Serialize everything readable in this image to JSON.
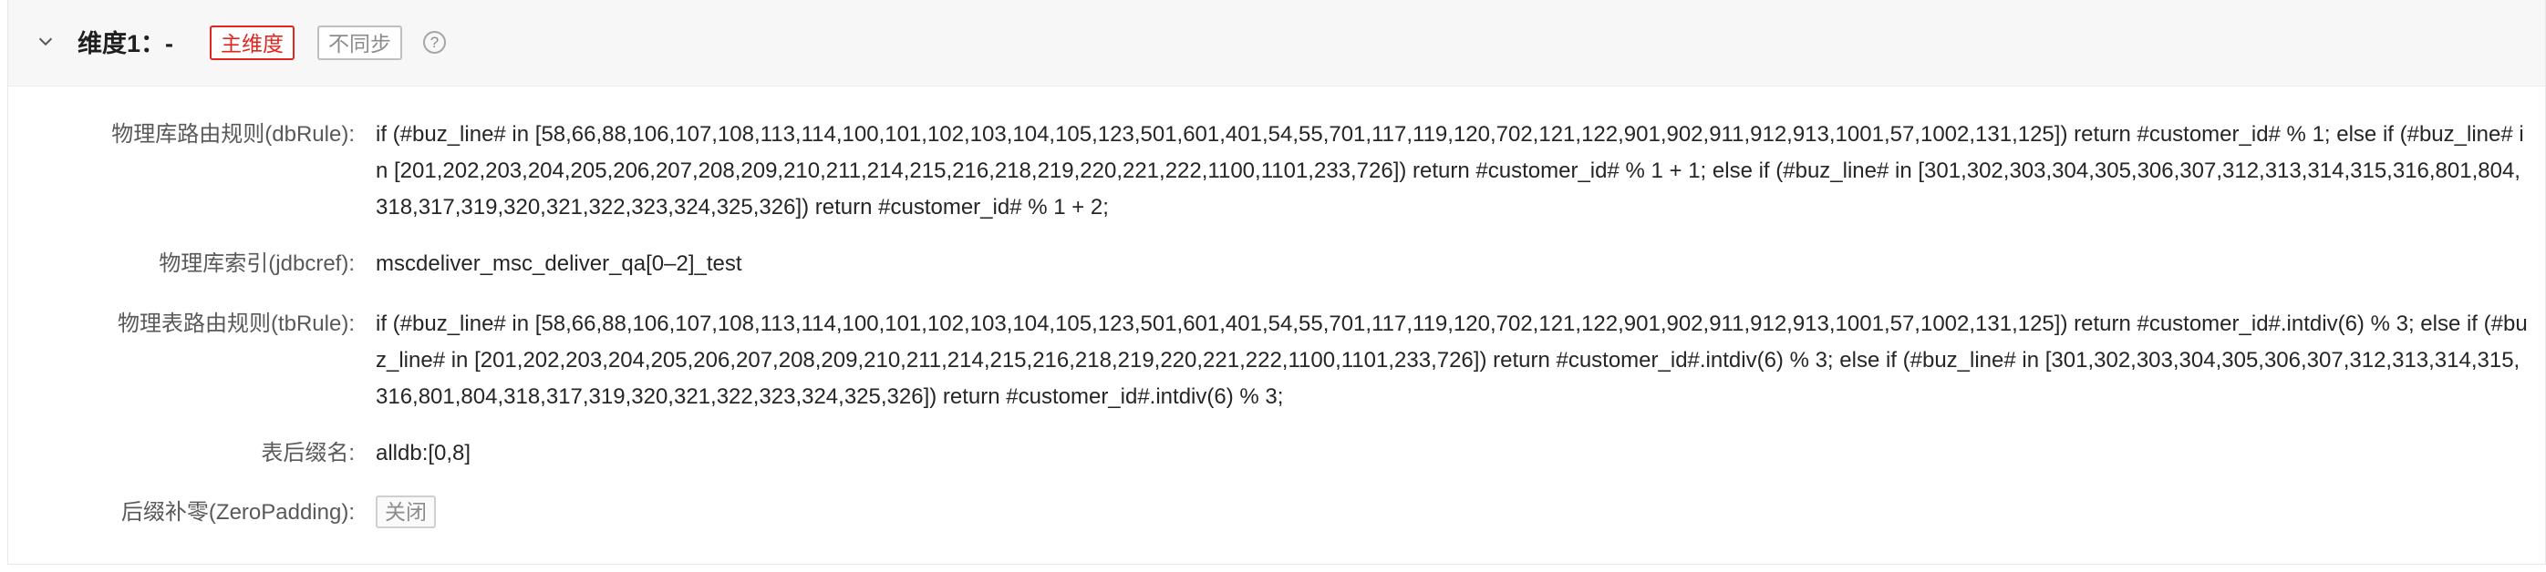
{
  "header": {
    "title": "维度1：-",
    "tag_main": "主维度",
    "tag_sync": "不同步",
    "help_glyph": "?"
  },
  "fields": {
    "db_rule": {
      "label": "物理库路由规则(dbRule):",
      "value": "if (#buz_line# in [58,66,88,106,107,108,113,114,100,101,102,103,104,105,123,501,601,401,54,55,701,117,119,120,702,121,122,901,902,911,912,913,1001,57,1002,131,125]) return #customer_id# % 1; else if (#buz_line# in [201,202,203,204,205,206,207,208,209,210,211,214,215,216,218,219,220,221,222,1100,1101,233,726]) return #customer_id# % 1 + 1; else if (#buz_line# in [301,302,303,304,305,306,307,312,313,314,315,316,801,804,318,317,319,320,321,322,323,324,325,326]) return #customer_id# % 1 + 2;"
    },
    "jdbc_ref": {
      "label": "物理库索引(jdbcref):",
      "value": "mscdeliver_msc_deliver_qa[0–2]_test"
    },
    "tb_rule": {
      "label": "物理表路由规则(tbRule):",
      "value": "if (#buz_line# in [58,66,88,106,107,108,113,114,100,101,102,103,104,105,123,501,601,401,54,55,701,117,119,120,702,121,122,901,902,911,912,913,1001,57,1002,131,125]) return #customer_id#.intdiv(6) % 3; else if (#buz_line# in [201,202,203,204,205,206,207,208,209,210,211,214,215,216,218,219,220,221,222,1100,1101,233,726]) return #customer_id#.intdiv(6) % 3; else if (#buz_line# in [301,302,303,304,305,306,307,312,313,314,315,316,801,804,318,317,319,320,321,322,323,324,325,326]) return #customer_id#.intdiv(6) % 3;"
    },
    "table_suffix": {
      "label": "表后缀名:",
      "value": "alldb:[0,8]"
    },
    "zero_padding": {
      "label": "后缀补零(ZeroPadding):",
      "value": "关闭"
    }
  },
  "icons": {
    "collapse": "chevron-down-icon",
    "help": "question-circle-icon"
  }
}
